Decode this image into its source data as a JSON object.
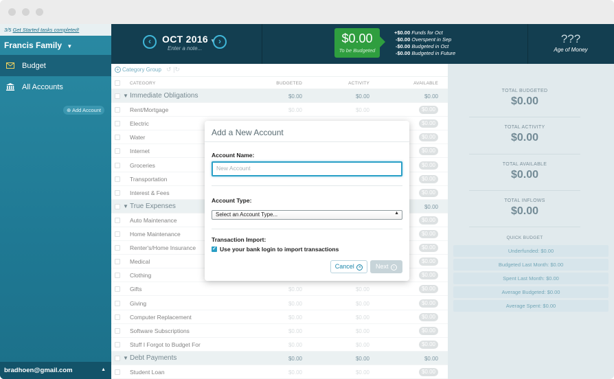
{
  "sidebar": {
    "started_progress": "3/5",
    "started_link": "Get Started tasks completed!",
    "budget_name": "Francis Family",
    "items": [
      {
        "label": "Budget",
        "icon": "envelope-icon"
      },
      {
        "label": "All Accounts",
        "icon": "bank-icon"
      }
    ],
    "add_account": "Add Account",
    "user_email": "bradhoen@gmail.com"
  },
  "header": {
    "month": "OCT 2016",
    "note_placeholder": "Enter a note...",
    "to_be_budgeted_amount": "$0.00",
    "to_be_budgeted_label": "To be Budgeted",
    "breakdown": [
      {
        "amount": "+$0.00",
        "label": "Funds for Oct"
      },
      {
        "amount": "-$0.00",
        "label": "Overspent in Sep"
      },
      {
        "amount": "-$0.00",
        "label": "Budgeted in Oct"
      },
      {
        "amount": "-$0.00",
        "label": "Budgeted in Future"
      }
    ],
    "age_of_money_value": "???",
    "age_of_money_label": "Age of Money"
  },
  "toolbar": {
    "category_group": "Category Group"
  },
  "table": {
    "headers": {
      "category": "CATEGORY",
      "budgeted": "BUDGETED",
      "activity": "ACTIVITY",
      "available": "AVAILABLE"
    },
    "rows": [
      {
        "type": "group",
        "name": "Immediate Obligations",
        "budgeted": "$0.00",
        "activity": "$0.00",
        "available": "$0.00"
      },
      {
        "type": "cat",
        "name": "Rent/Mortgage",
        "budgeted": "$0.00",
        "activity": "$0.00",
        "available": "$0.00"
      },
      {
        "type": "cat",
        "name": "Electric",
        "budgeted": "$0.00",
        "activity": "$0.00",
        "available": "$0.00"
      },
      {
        "type": "cat",
        "name": "Water",
        "budgeted": "$0.00",
        "activity": "$0.00",
        "available": "$0.00"
      },
      {
        "type": "cat",
        "name": "Internet",
        "budgeted": "$0.00",
        "activity": "$0.00",
        "available": "$0.00"
      },
      {
        "type": "cat",
        "name": "Groceries",
        "budgeted": "$0.00",
        "activity": "$0.00",
        "available": "$0.00"
      },
      {
        "type": "cat",
        "name": "Transportation",
        "budgeted": "$0.00",
        "activity": "$0.00",
        "available": "$0.00"
      },
      {
        "type": "cat",
        "name": "Interest & Fees",
        "budgeted": "$0.00",
        "activity": "$0.00",
        "available": "$0.00"
      },
      {
        "type": "group",
        "name": "True Expenses",
        "budgeted": "$0.00",
        "activity": "$0.00",
        "available": "$0.00"
      },
      {
        "type": "cat",
        "name": "Auto Maintenance",
        "budgeted": "$0.00",
        "activity": "$0.00",
        "available": "$0.00"
      },
      {
        "type": "cat",
        "name": "Home Maintenance",
        "budgeted": "$0.00",
        "activity": "$0.00",
        "available": "$0.00"
      },
      {
        "type": "cat",
        "name": "Renter's/Home Insurance",
        "budgeted": "$0.00",
        "activity": "$0.00",
        "available": "$0.00"
      },
      {
        "type": "cat",
        "name": "Medical",
        "budgeted": "$0.00",
        "activity": "$0.00",
        "available": "$0.00"
      },
      {
        "type": "cat",
        "name": "Clothing",
        "budgeted": "$0.00",
        "activity": "$0.00",
        "available": "$0.00"
      },
      {
        "type": "cat",
        "name": "Gifts",
        "budgeted": "$0.00",
        "activity": "$0.00",
        "available": "$0.00"
      },
      {
        "type": "cat",
        "name": "Giving",
        "budgeted": "$0.00",
        "activity": "$0.00",
        "available": "$0.00"
      },
      {
        "type": "cat",
        "name": "Computer Replacement",
        "budgeted": "$0.00",
        "activity": "$0.00",
        "available": "$0.00"
      },
      {
        "type": "cat",
        "name": "Software Subscriptions",
        "budgeted": "$0.00",
        "activity": "$0.00",
        "available": "$0.00"
      },
      {
        "type": "cat",
        "name": "Stuff I Forgot to Budget For",
        "budgeted": "$0.00",
        "activity": "$0.00",
        "available": "$0.00"
      },
      {
        "type": "group",
        "name": "Debt Payments",
        "budgeted": "$0.00",
        "activity": "$0.00",
        "available": "$0.00"
      },
      {
        "type": "cat",
        "name": "Student Loan",
        "budgeted": "$0.00",
        "activity": "$0.00",
        "available": "$0.00"
      }
    ]
  },
  "inspector": {
    "totals": [
      {
        "label": "TOTAL BUDGETED",
        "value": "$0.00"
      },
      {
        "label": "TOTAL ACTIVITY",
        "value": "$0.00"
      },
      {
        "label": "TOTAL AVAILABLE",
        "value": "$0.00"
      },
      {
        "label": "TOTAL INFLOWS",
        "value": "$0.00"
      }
    ],
    "quick_budget_title": "QUICK BUDGET",
    "quick_budget": [
      "Underfunded: $0.00",
      "Budgeted Last Month: $0.00",
      "Spent Last Month: $0.00",
      "Average Budgeted: $0.00",
      "Average Spent: $0.00"
    ]
  },
  "modal": {
    "title": "Add a New Account",
    "account_name_label": "Account Name:",
    "account_name_placeholder": "New Account",
    "account_name_value": "",
    "account_type_label": "Account Type:",
    "account_type_selected": "Select an Account Type...",
    "import_label": "Transaction Import:",
    "import_checkbox_label": "Use your bank login to import transactions",
    "import_checked": true,
    "cancel_label": "Cancel",
    "next_label": "Next"
  },
  "colors": {
    "accent": "#2aa0c7",
    "header_bg": "#133e50",
    "sidebar_bg": "#1f7994",
    "to_be_budgeted_bg": "#2f9e3f",
    "inspector_bg": "#cfdde2"
  }
}
